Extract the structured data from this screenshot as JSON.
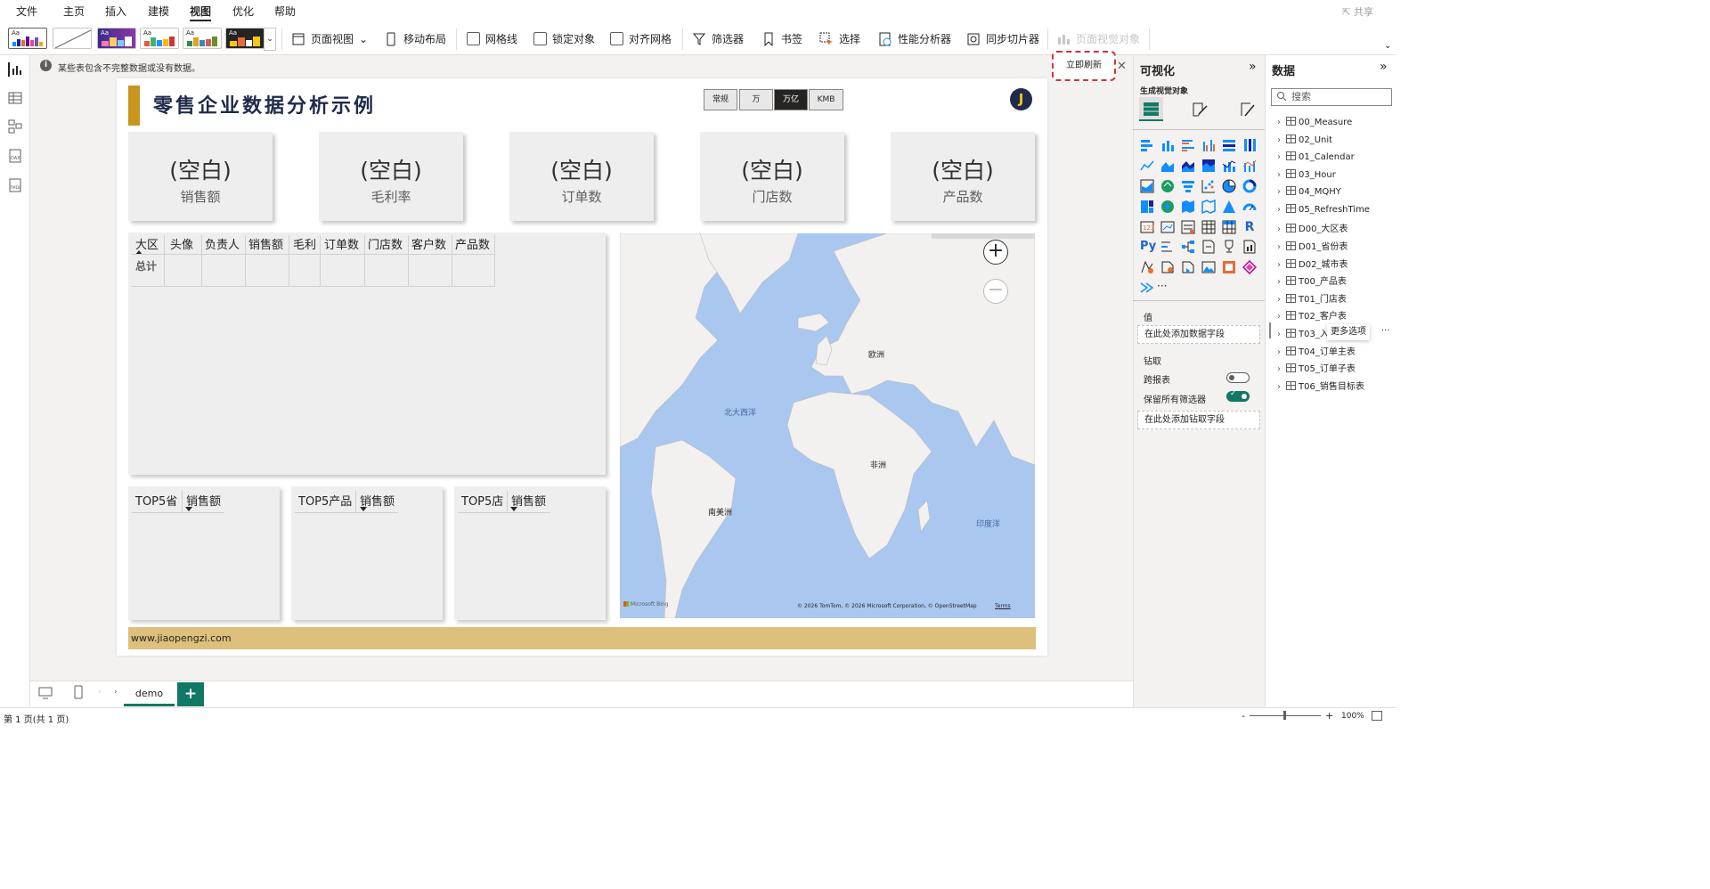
{
  "menu": {
    "items": [
      "文件",
      "主页",
      "插入",
      "建模",
      "视图",
      "优化",
      "帮助"
    ],
    "share": "共享"
  },
  "ribbon": {
    "page_view": "页面视图",
    "mobile_layout": "移动布局",
    "gridlines": "网格线",
    "lock_objects": "锁定对象",
    "snap_grid": "对齐网格",
    "filters": "筛选器",
    "bookmarks": "书签",
    "selection": "选择",
    "perf_analyzer": "性能分析器",
    "sync_slicers": "同步切片器",
    "page_visuals": "页面视觉对象"
  },
  "infobar": {
    "message": "某些表包含不完整数据或没有数据。",
    "refresh": "立即刷新"
  },
  "report": {
    "title": "零售企业数据分析示例",
    "units": [
      "常规",
      "万",
      "万亿",
      "KMB"
    ],
    "avatar": "J",
    "kpis": [
      {
        "value": "(空白)",
        "label": "销售额"
      },
      {
        "value": "(空白)",
        "label": "毛利率"
      },
      {
        "value": "(空白)",
        "label": "订单数"
      },
      {
        "value": "(空白)",
        "label": "门店数"
      },
      {
        "value": "(空白)",
        "label": "产品数"
      }
    ],
    "table": {
      "headers": [
        "大区",
        "头像",
        "负责人",
        "销售额",
        "毛利",
        "订单数",
        "门店数",
        "客户数",
        "产品数"
      ],
      "total": "总计"
    },
    "top5": [
      {
        "h1": "TOP5省",
        "h2": "销售额"
      },
      {
        "h1": "TOP5产品",
        "h2": "销售额"
      },
      {
        "h1": "TOP5店",
        "h2": "销售额"
      }
    ],
    "map": {
      "labels": {
        "europe": "欧洲",
        "africa": "非洲",
        "south_america": "南美洲",
        "north_atlantic": "北大西洋",
        "indian_ocean": "印度洋"
      },
      "zoom_in": "+",
      "zoom_out": "−",
      "brand": "Microsoft Bing",
      "copyright": "© 2026 TomTom, © 2026 Microsoft Corporation, © OpenStreetMap",
      "terms": "Terms"
    },
    "footer": "www.jiaopengzi.com"
  },
  "pages": {
    "tab": "demo",
    "add": "+"
  },
  "status": {
    "page": "第 1 页(共 1 页)",
    "zoom": "100%"
  },
  "viz_pane": {
    "title": "可视化",
    "build_label": "生成视觉对象",
    "values_label": "值",
    "values_drop": "在此处添加数据字段",
    "drill_label": "钻取",
    "cross_report": "跨报表",
    "keep_filters": "保留所有筛选器",
    "drill_drop": "在此处添加钻取字段",
    "more": "···"
  },
  "data_pane": {
    "title": "数据",
    "search_placeholder": "搜索",
    "tables": [
      "00_Measure",
      "02_Unit",
      "01_Calendar",
      "03_Hour",
      "04_MQHY",
      "05_RefreshTime",
      "D00_大区表",
      "D01_省份表",
      "D02_城市表",
      "T00_产品表",
      "T01_门店表",
      "T02_客户表",
      "T03_入",
      "T04_订单主表",
      "T05_订单子表",
      "T06_销售目标表"
    ],
    "tooltip": "更多选项",
    "more": "···"
  },
  "colors": {
    "accent": "#117865",
    "title_bar": "#c8961e",
    "footer": "#dcc07c",
    "map_water": "#aac7f0",
    "highlight": "#d13438"
  }
}
